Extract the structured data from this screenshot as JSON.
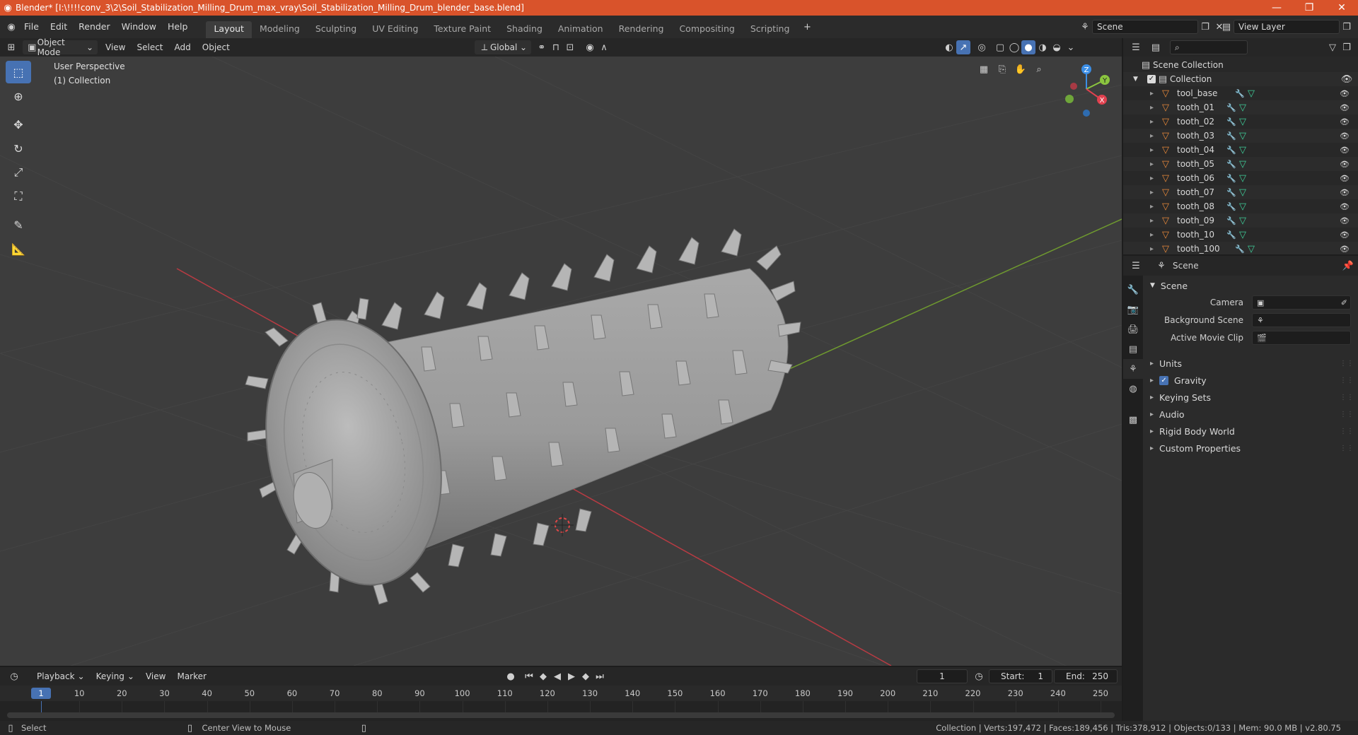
{
  "window": {
    "title": "Blender* [I:\\!!!!conv_3\\2\\Soil_Stabilization_Milling_Drum_max_vray\\Soil_Stabilization_Milling_Drum_blender_base.blend]"
  },
  "menu": [
    "File",
    "Edit",
    "Render",
    "Window",
    "Help"
  ],
  "workspaces": [
    "Layout",
    "Modeling",
    "Sculpting",
    "UV Editing",
    "Texture Paint",
    "Shading",
    "Animation",
    "Rendering",
    "Compositing",
    "Scripting"
  ],
  "scene_selector": {
    "label": "Scene",
    "view_layer": "View Layer"
  },
  "viewport_header": {
    "mode": "Object Mode",
    "menus": [
      "View",
      "Select",
      "Add",
      "Object"
    ],
    "orientation": "Global"
  },
  "viewport": {
    "overlay_line1": "User Perspective",
    "overlay_line2": "(1) Collection",
    "gizmo": {
      "x": "X",
      "y": "Y",
      "z": "Z"
    }
  },
  "outliner": {
    "root": "Scene Collection",
    "collection": "Collection",
    "items": [
      "tool_base",
      "tooth_01",
      "tooth_02",
      "tooth_03",
      "tooth_04",
      "tooth_05",
      "tooth_06",
      "tooth_07",
      "tooth_08",
      "tooth_09",
      "tooth_10",
      "tooth_100"
    ]
  },
  "properties": {
    "header": "Scene",
    "panel": "Scene",
    "fields": [
      {
        "label": "Camera"
      },
      {
        "label": "Background Scene"
      },
      {
        "label": "Active Movie Clip"
      }
    ],
    "sections": [
      "Units",
      "Gravity",
      "Keying Sets",
      "Audio",
      "Rigid Body World",
      "Custom Properties"
    ],
    "gravity_checked": true
  },
  "timeline": {
    "menus": [
      "Playback",
      "Keying",
      "View",
      "Marker"
    ],
    "current_frame": "1",
    "start_label": "Start:",
    "start": "1",
    "end_label": "End:",
    "end": "250",
    "ticks": [
      "1",
      "10",
      "20",
      "30",
      "40",
      "50",
      "60",
      "70",
      "80",
      "90",
      "100",
      "110",
      "120",
      "130",
      "140",
      "150",
      "160",
      "170",
      "180",
      "190",
      "200",
      "210",
      "220",
      "230",
      "240",
      "250"
    ]
  },
  "statusbar": {
    "left1": "Select",
    "left2": "Center View to Mouse",
    "right": "Collection | Verts:197,472 | Faces:189,456 | Tris:378,912 | Objects:0/133 | Mem: 90.0 MB | v2.80.75"
  },
  "colors": {
    "titlebar": "#d9532b",
    "accent": "#4772b3",
    "axis_x": "#e2414f",
    "axis_y": "#8bc53f",
    "axis_z": "#3b8ee6",
    "viewport_bg": "#3d3d3d"
  }
}
